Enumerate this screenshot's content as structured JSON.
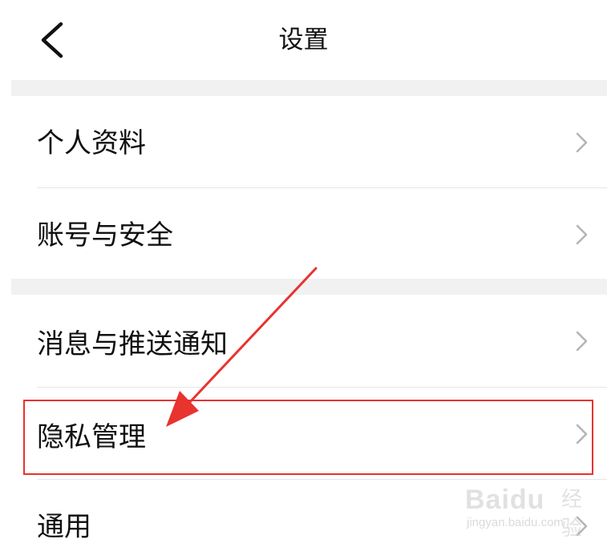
{
  "header": {
    "title": "设置",
    "back_icon": "chevron-left-icon"
  },
  "groups": [
    {
      "items": [
        {
          "label": "个人资料",
          "icon": "chevron-right-icon"
        },
        {
          "label": "账号与安全",
          "icon": "chevron-right-icon"
        }
      ]
    },
    {
      "items": [
        {
          "label": "消息与推送通知",
          "icon": "chevron-right-icon"
        },
        {
          "label": "隐私管理",
          "icon": "chevron-right-icon",
          "highlighted": true
        },
        {
          "label": "通用",
          "icon": "chevron-right-icon"
        }
      ]
    }
  ],
  "annotation": {
    "highlight_color": "#e8332f",
    "target": "隐私管理"
  },
  "watermark": {
    "brand": "Baidu",
    "suffix": "经验",
    "domain": "jingyan.baidu.com"
  },
  "colors": {
    "background": "#ffffff",
    "section_gap": "#f1f1f1",
    "divider": "#e6e6e6",
    "text": "#111111",
    "chevron": "#b5b5b5",
    "accent_red": "#e8332f"
  }
}
